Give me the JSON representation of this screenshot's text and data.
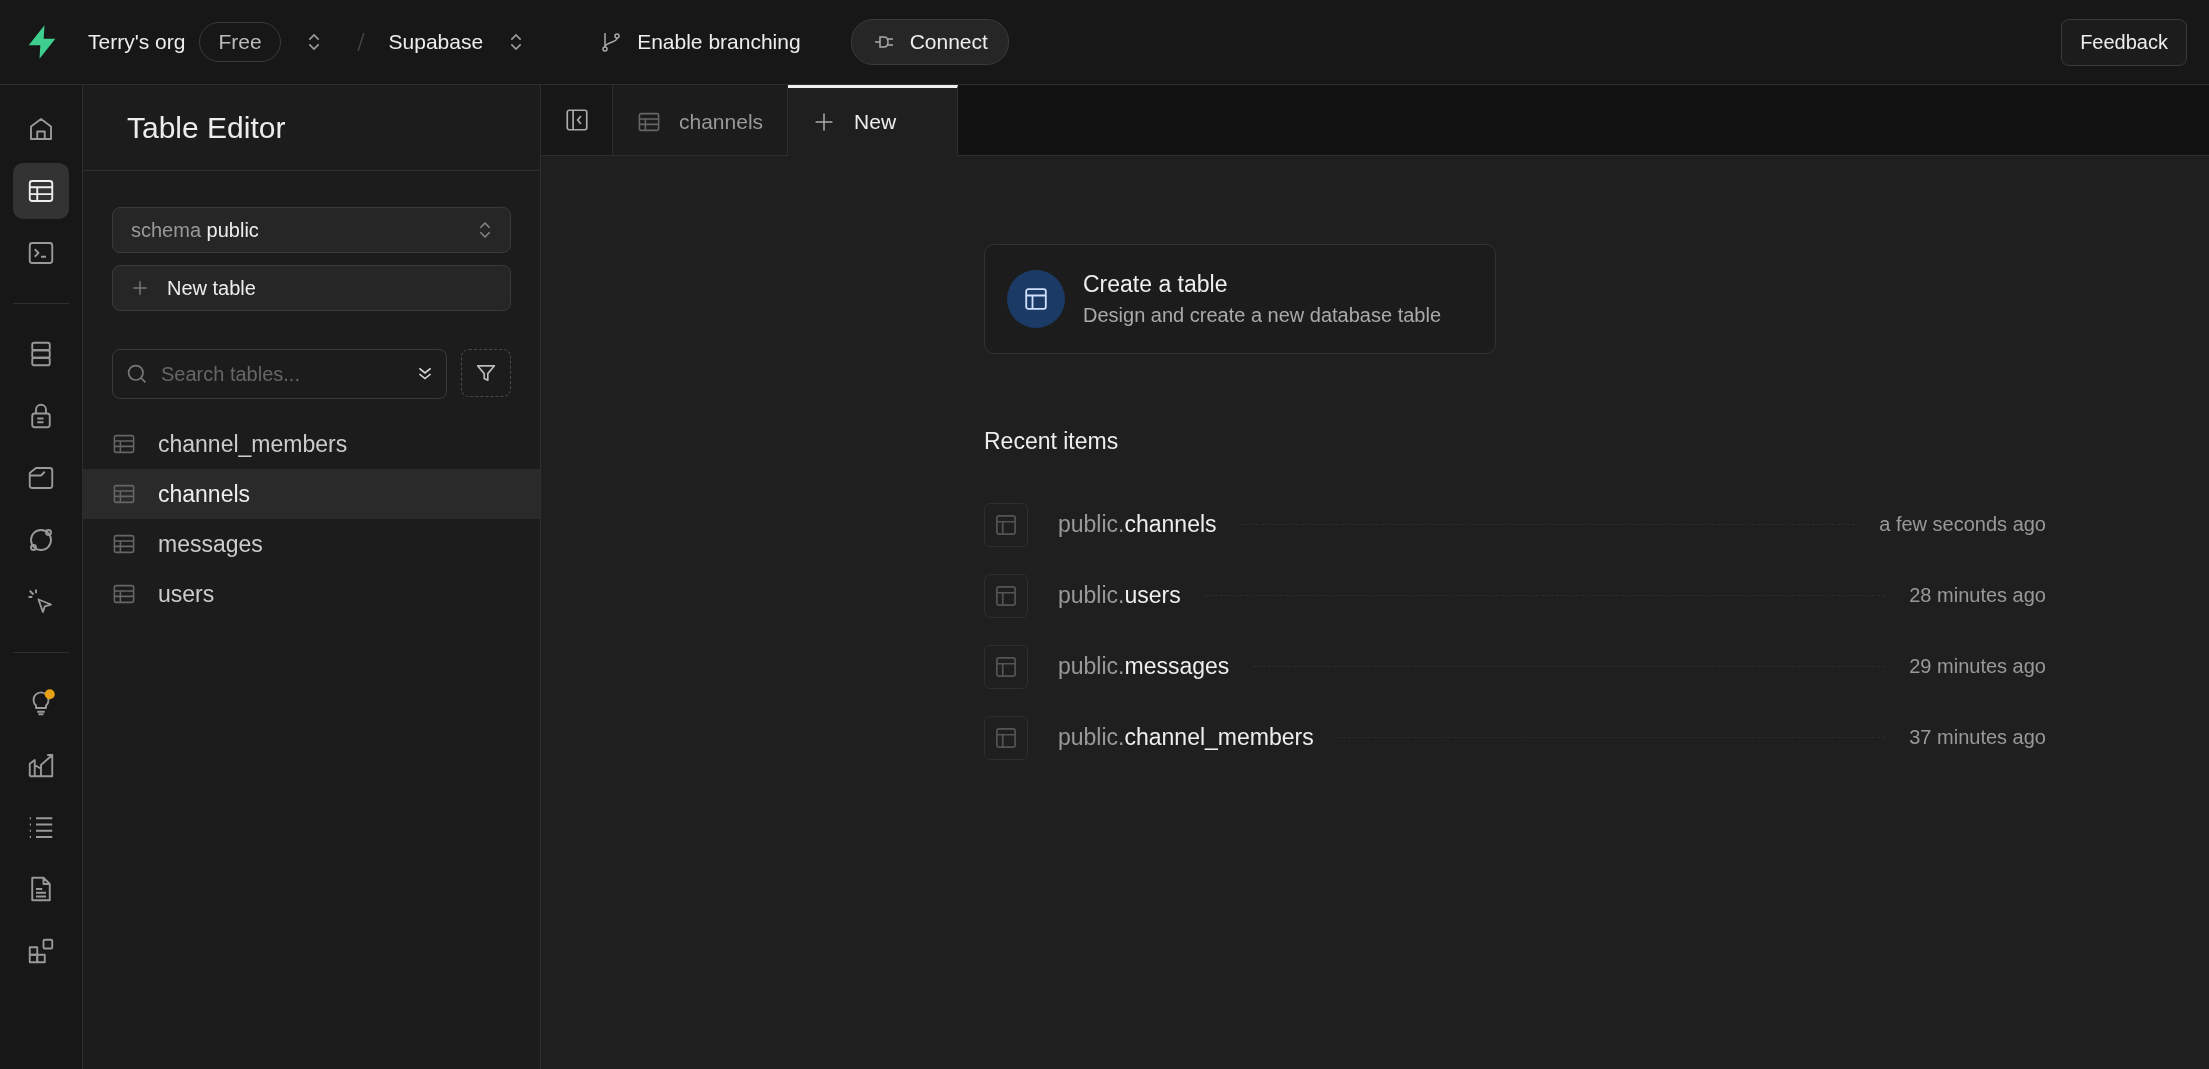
{
  "topbar": {
    "org": "Terry's org",
    "plan": "Free",
    "project": "Supabase",
    "branching": "Enable branching",
    "connect": "Connect",
    "feedback": "Feedback"
  },
  "nav_groups": [
    [
      {
        "kind": "home",
        "selected": false,
        "notification": false
      },
      {
        "kind": "table",
        "selected": true,
        "notification": false
      },
      {
        "kind": "terminal",
        "selected": false,
        "notification": false
      }
    ],
    [
      {
        "kind": "database",
        "selected": false,
        "notification": false
      },
      {
        "kind": "lock",
        "selected": false,
        "notification": false
      },
      {
        "kind": "folder",
        "selected": false,
        "notification": false
      },
      {
        "kind": "orbit",
        "selected": false,
        "notification": false
      },
      {
        "kind": "cursor",
        "selected": false,
        "notification": false
      }
    ],
    [
      {
        "kind": "bulb",
        "selected": false,
        "notification": true
      },
      {
        "kind": "chart",
        "selected": false,
        "notification": false
      },
      {
        "kind": "list",
        "selected": false,
        "notification": false
      },
      {
        "kind": "document",
        "selected": false,
        "notification": false
      },
      {
        "kind": "blocks",
        "selected": false,
        "notification": false
      }
    ]
  ],
  "panel": {
    "title": "Table Editor",
    "schema_label": "schema",
    "schema_value": "public",
    "new_table": "New table",
    "search": {
      "placeholder": "Search tables..."
    },
    "tables": [
      {
        "name": "channel_members",
        "selected": false
      },
      {
        "name": "channels",
        "selected": true
      },
      {
        "name": "messages",
        "selected": false
      },
      {
        "name": "users",
        "selected": false
      }
    ]
  },
  "tabs": [
    {
      "label": "channels",
      "kind": "table",
      "selected": false
    },
    {
      "label": "New",
      "kind": "new",
      "selected": true
    }
  ],
  "create_card": {
    "title": "Create a table",
    "subtitle": "Design and create a new database table"
  },
  "recent": {
    "title": "Recent items",
    "items": [
      {
        "schema": "public.",
        "name": "channels",
        "time": "a few seconds ago"
      },
      {
        "schema": "public.",
        "name": "users",
        "time": "28 minutes ago"
      },
      {
        "schema": "public.",
        "name": "messages",
        "time": "29 minutes ago"
      },
      {
        "schema": "public.",
        "name": "channel_members",
        "time": "37 minutes ago"
      }
    ]
  }
}
